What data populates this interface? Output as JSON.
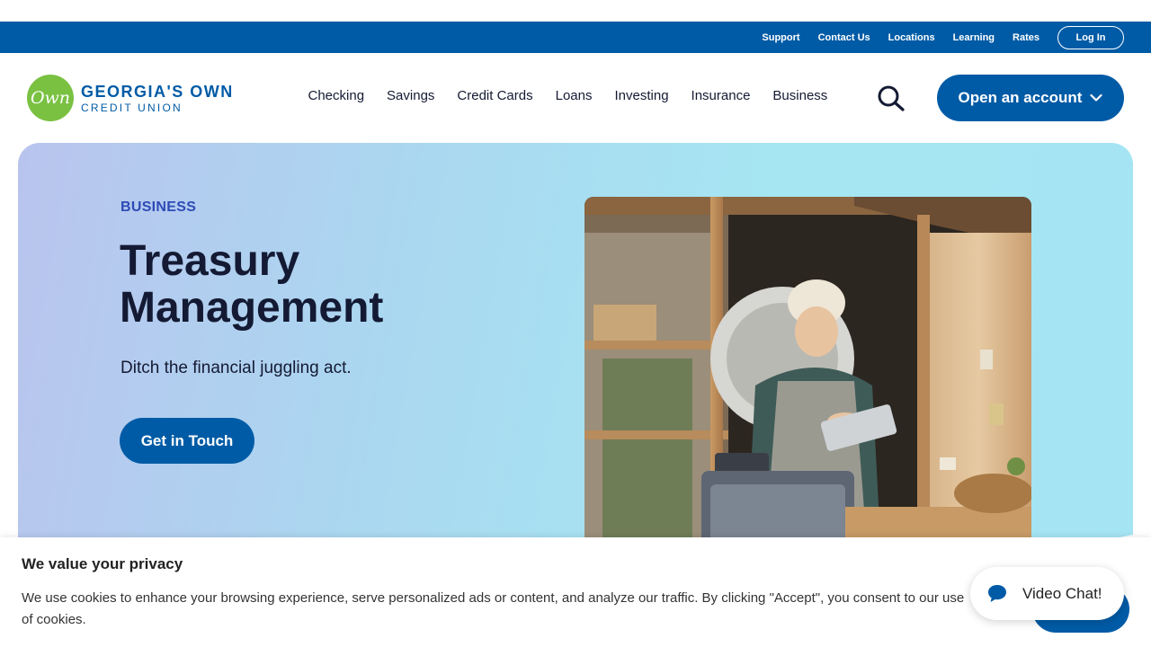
{
  "utility_nav": {
    "links": [
      "Support",
      "Contact Us",
      "Locations",
      "Learning",
      "Rates"
    ],
    "login_label": "Log In"
  },
  "logo": {
    "mark": "Own",
    "line1": "GEORGIA'S OWN",
    "line2": "CREDIT UNION"
  },
  "main_nav": {
    "items": [
      "Checking",
      "Savings",
      "Credit Cards",
      "Loans",
      "Investing",
      "Insurance",
      "Business"
    ],
    "search_icon": "search-icon",
    "open_account_label": "Open an account",
    "open_account_icon": "chevron-down-icon"
  },
  "hero": {
    "eyebrow": "BUSINESS",
    "title": "Treasury Management",
    "subtitle": "Ditch the financial juggling act.",
    "cta_label": "Get in Touch",
    "photo_icon": "shopkeeper-with-tablet-photo"
  },
  "cookie_banner": {
    "title": "We value your privacy",
    "text": "We use cookies to enhance your browsing experience, serve personalized ads or content, and analyze our traffic. By clicking \"Accept\", you consent to our use of cookies."
  },
  "video_chat": {
    "label": "Video Chat!",
    "icon": "chat-bubble-icon"
  },
  "colors": {
    "brand_blue": "#005ba6",
    "brand_green": "#7ac142",
    "heading": "#141a33",
    "eyebrow": "#2e4bb6"
  }
}
